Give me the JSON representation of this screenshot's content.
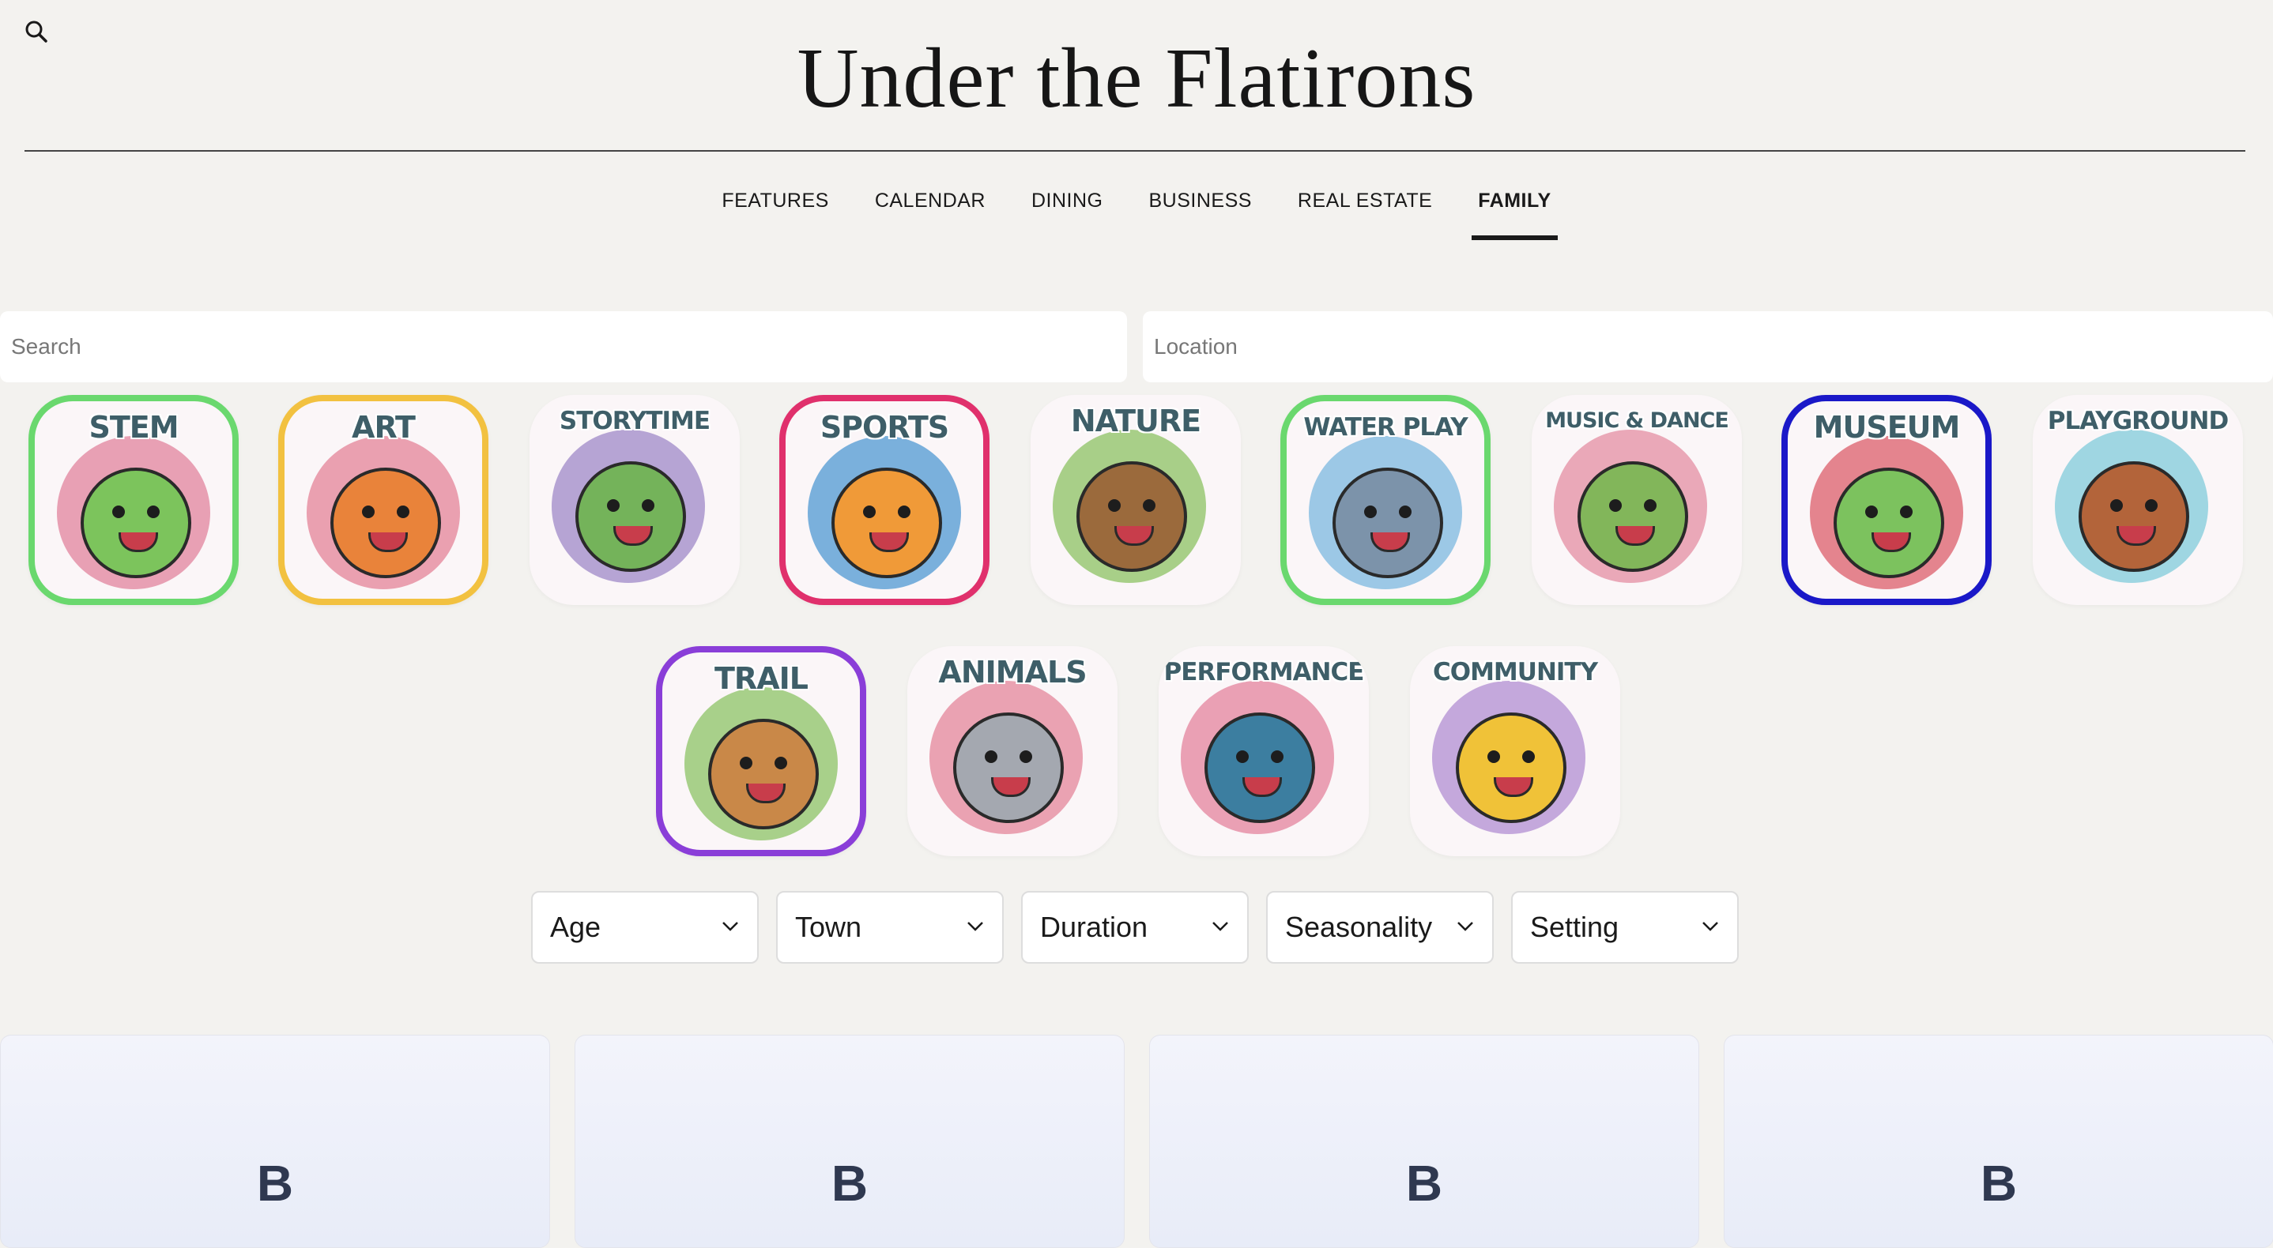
{
  "site": {
    "title": "Under the Flatirons"
  },
  "nav": [
    {
      "label": "FEATURES"
    },
    {
      "label": "CALENDAR"
    },
    {
      "label": "DINING"
    },
    {
      "label": "BUSINESS"
    },
    {
      "label": "REAL ESTATE"
    },
    {
      "label": "FAMILY",
      "active": true
    }
  ],
  "search": {
    "placeholder": "Search"
  },
  "location": {
    "placeholder": "Location"
  },
  "categories": [
    {
      "label": "STEM",
      "selected": true,
      "border_color": "#6ad86e",
      "blob_color": "#e8a0b4",
      "body_color": "#7cc45c"
    },
    {
      "label": "ART",
      "selected": true,
      "border_color": "#f2c140",
      "blob_color": "#eaa0b0",
      "body_color": "#e9833a"
    },
    {
      "label": "STORYTIME",
      "selected": false,
      "blob_color": "#b6a4d4",
      "body_color": "#74b35a"
    },
    {
      "label": "SPORTS",
      "selected": true,
      "border_color": "#e0306c",
      "blob_color": "#7ab0dc",
      "body_color": "#f09a38"
    },
    {
      "label": "NATURE",
      "selected": false,
      "blob_color": "#a8cf88",
      "body_color": "#9b6a3c"
    },
    {
      "label": "WATER PLAY",
      "selected": true,
      "border_color": "#6ad86e",
      "blob_color": "#9cc8e6",
      "body_color": "#7c93aa"
    },
    {
      "label": "MUSIC & DANCE",
      "selected": false,
      "blob_color": "#eaa8b8",
      "body_color": "#82b65a"
    },
    {
      "label": "MUSEUM",
      "selected": true,
      "border_color": "#1a18c8",
      "blob_color": "#e4848e",
      "body_color": "#7cc25e"
    },
    {
      "label": "PLAYGROUND",
      "selected": false,
      "blob_color": "#9fd6e2",
      "body_color": "#b3643a"
    },
    {
      "label": "TRAIL",
      "selected": true,
      "border_color": "#8a3ed8",
      "blob_color": "#a8d08a",
      "body_color": "#c98848"
    },
    {
      "label": "ANIMALS",
      "selected": false,
      "blob_color": "#eaa2b2",
      "body_color": "#a4a8b0"
    },
    {
      "label": "PERFORMANCE",
      "selected": false,
      "blob_color": "#eaa0b4",
      "body_color": "#3c7ea0"
    },
    {
      "label": "COMMUNITY",
      "selected": false,
      "blob_color": "#c4a8dc",
      "body_color": "#f0c238"
    }
  ],
  "filters": [
    {
      "label": "Age"
    },
    {
      "label": "Town"
    },
    {
      "label": "Duration"
    },
    {
      "label": "Seasonality"
    },
    {
      "label": "Setting"
    }
  ],
  "cards": [
    {
      "letter": "B"
    },
    {
      "letter": "B"
    },
    {
      "letter": "B"
    },
    {
      "letter": "B"
    }
  ]
}
